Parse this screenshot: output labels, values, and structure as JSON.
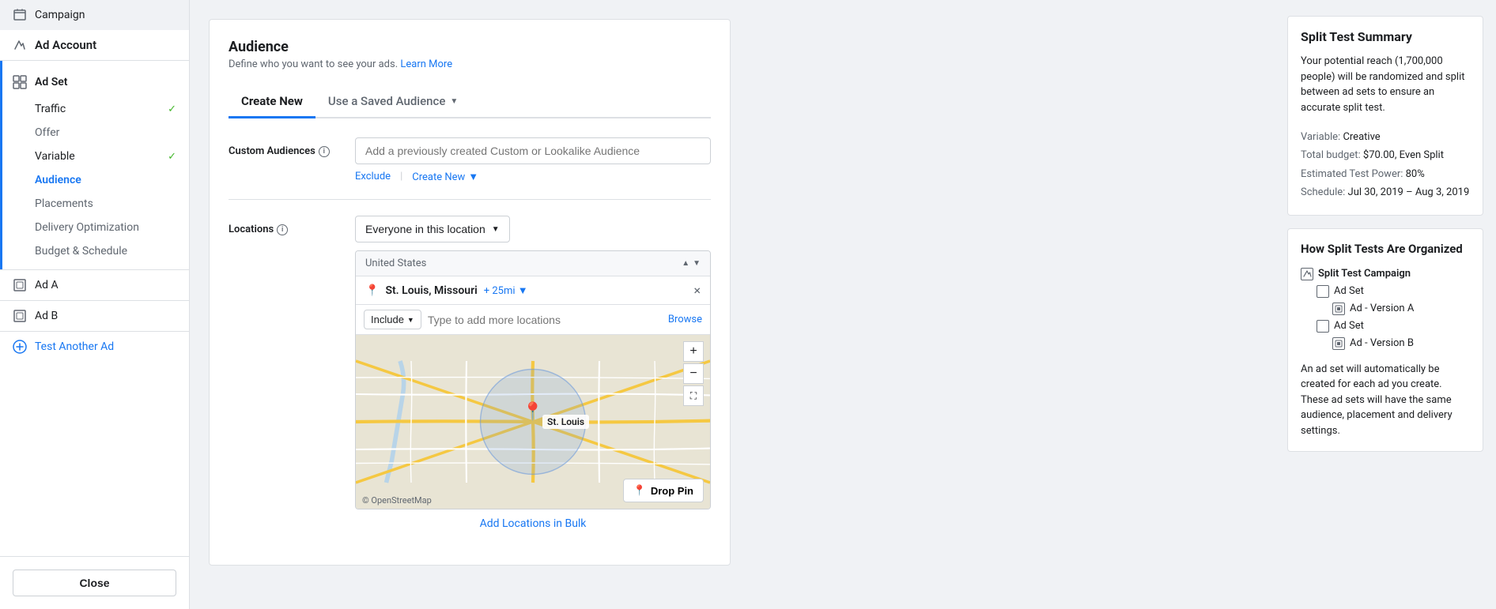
{
  "sidebar": {
    "campaign_label": "Campaign",
    "ad_account_label": "Ad Account",
    "ad_set_label": "Ad Set",
    "sub_items": [
      {
        "label": "Traffic",
        "state": "check"
      },
      {
        "label": "Offer",
        "state": "none"
      },
      {
        "label": "Variable",
        "state": "check"
      },
      {
        "label": "Audience",
        "state": "active"
      },
      {
        "label": "Placements",
        "state": "none"
      },
      {
        "label": "Delivery Optimization",
        "state": "none"
      },
      {
        "label": "Budget & Schedule",
        "state": "none"
      }
    ],
    "ad_a_label": "Ad A",
    "ad_b_label": "Ad B",
    "test_another_label": "Test Another Ad",
    "close_label": "Close"
  },
  "main": {
    "title": "Audience",
    "subtitle": "Define who you want to see your ads.",
    "learn_more": "Learn More",
    "tabs": [
      {
        "label": "Create New"
      },
      {
        "label": "Use a Saved Audience"
      }
    ],
    "custom_audiences_label": "Custom Audiences",
    "custom_audiences_placeholder": "Add a previously created Custom or Lookalike Audience",
    "exclude_label": "Exclude",
    "create_new_label": "Create New",
    "locations_label": "Locations",
    "location_dropdown": "Everyone in this location",
    "location_country": "United States",
    "location_city": "St. Louis, Missouri",
    "location_radius": "+ 25mi",
    "include_label": "Include",
    "location_search_placeholder": "Type to add more locations",
    "browse_label": "Browse",
    "map_copyright": "© OpenStreetMap",
    "drop_pin_label": "Drop Pin",
    "add_locations_label": "Add Locations in Bulk"
  },
  "right_panel": {
    "split_summary_title": "Split Test Summary",
    "split_summary_text": "Your potential reach (1,700,000 people) will be randomized and split between ad sets to ensure an accurate split test.",
    "variable_label": "Variable:",
    "variable_value": "Creative",
    "budget_label": "Total budget:",
    "budget_value": "$70.00, Even Split",
    "power_label": "Estimated Test Power:",
    "power_value": "80%",
    "schedule_label": "Schedule:",
    "schedule_value": "Jul 30, 2019 – Aug 3, 2019",
    "org_title": "How Split Tests Are Organized",
    "campaign_label": "Split Test Campaign",
    "ad_set_a": "Ad Set",
    "ad_version_a": "Ad - Version A",
    "ad_set_b": "Ad Set",
    "ad_version_b": "Ad - Version B",
    "org_desc": "An ad set will automatically be created for each ad you create. These ad sets will have the same audience, placement and delivery settings."
  }
}
